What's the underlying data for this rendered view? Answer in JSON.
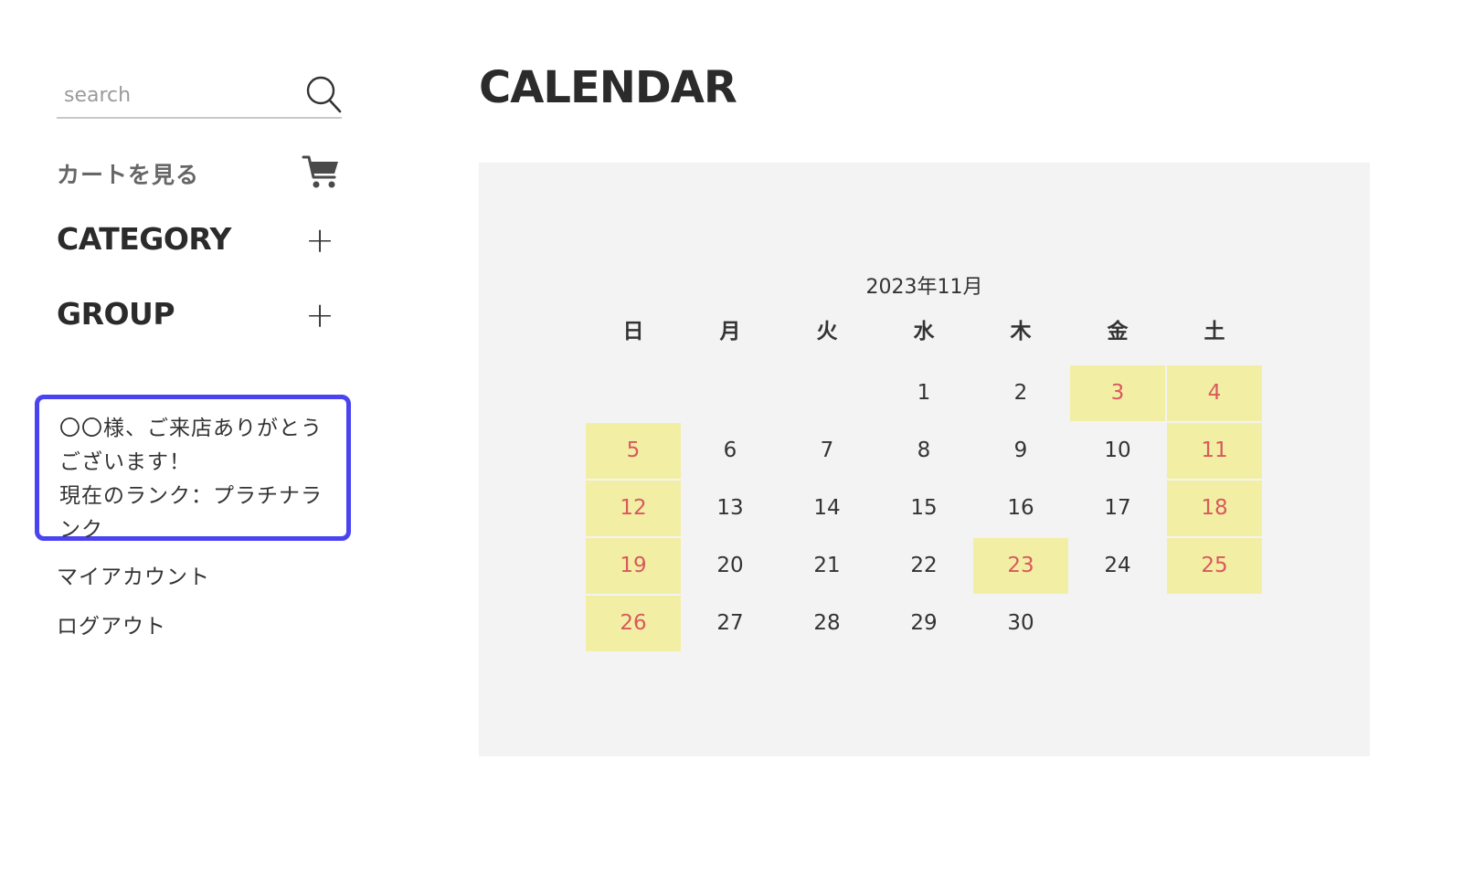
{
  "sidebar": {
    "search": {
      "placeholder": "search"
    },
    "cart_label": "カートを見る",
    "category_label": "CATEGORY",
    "group_label": "GROUP",
    "plus_symbol": "+",
    "welcome": {
      "line1": "〇〇様、ご来店ありがとう",
      "line2": "ございます！",
      "line3": "現在のランク：プラチナラ",
      "line4": "ンク"
    },
    "links": {
      "my_account": "マイアカウント",
      "logout": "ログアウト"
    }
  },
  "main": {
    "title": "CALENDAR",
    "calendar": {
      "caption": "2023年11月",
      "weekdays": [
        "日",
        "月",
        "火",
        "水",
        "木",
        "金",
        "土"
      ],
      "weeks": [
        [
          "",
          "",
          "",
          "1",
          "2",
          "3",
          "4"
        ],
        [
          "5",
          "6",
          "7",
          "8",
          "9",
          "10",
          "11"
        ],
        [
          "12",
          "13",
          "14",
          "15",
          "16",
          "17",
          "18"
        ],
        [
          "19",
          "20",
          "21",
          "22",
          "23",
          "24",
          "25"
        ],
        [
          "26",
          "27",
          "28",
          "29",
          "30",
          "",
          ""
        ]
      ],
      "holidays": [
        "3",
        "4",
        "5",
        "11",
        "12",
        "18",
        "19",
        "23",
        "25",
        "26"
      ],
      "holiday_bg": "#f2efa5",
      "holiday_text": "#d9595d"
    }
  },
  "colors": {
    "highlight_border": "#4a43f0",
    "panel_bg": "#f3f3f3"
  }
}
